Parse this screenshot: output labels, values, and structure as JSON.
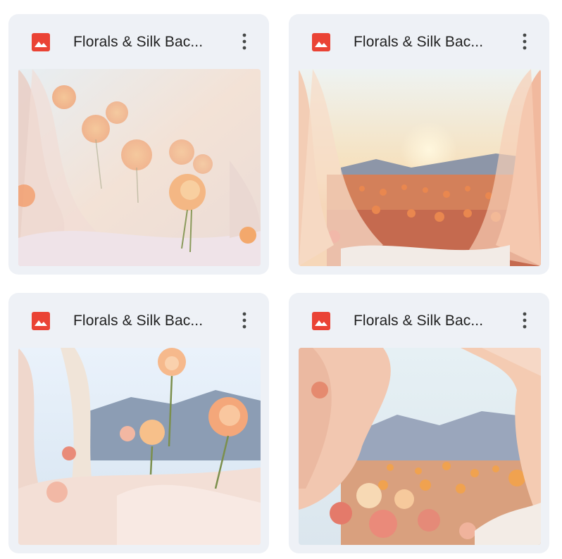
{
  "files": [
    {
      "title": "Florals & Silk Bac...",
      "icon": "image-file-icon",
      "menu_icon": "more-vert-icon",
      "icon_color": "#ea4335"
    },
    {
      "title": "Florals & Silk Bac...",
      "icon": "image-file-icon",
      "menu_icon": "more-vert-icon",
      "icon_color": "#ea4335"
    },
    {
      "title": "Florals & Silk Bac...",
      "icon": "image-file-icon",
      "menu_icon": "more-vert-icon",
      "icon_color": "#ea4335"
    },
    {
      "title": "Florals & Silk Bac...",
      "icon": "image-file-icon",
      "menu_icon": "more-vert-icon",
      "icon_color": "#ea4335"
    }
  ],
  "colors": {
    "card_bg": "#eef1f6",
    "title_text": "#1f1f1f",
    "menu_dots": "#444746"
  }
}
